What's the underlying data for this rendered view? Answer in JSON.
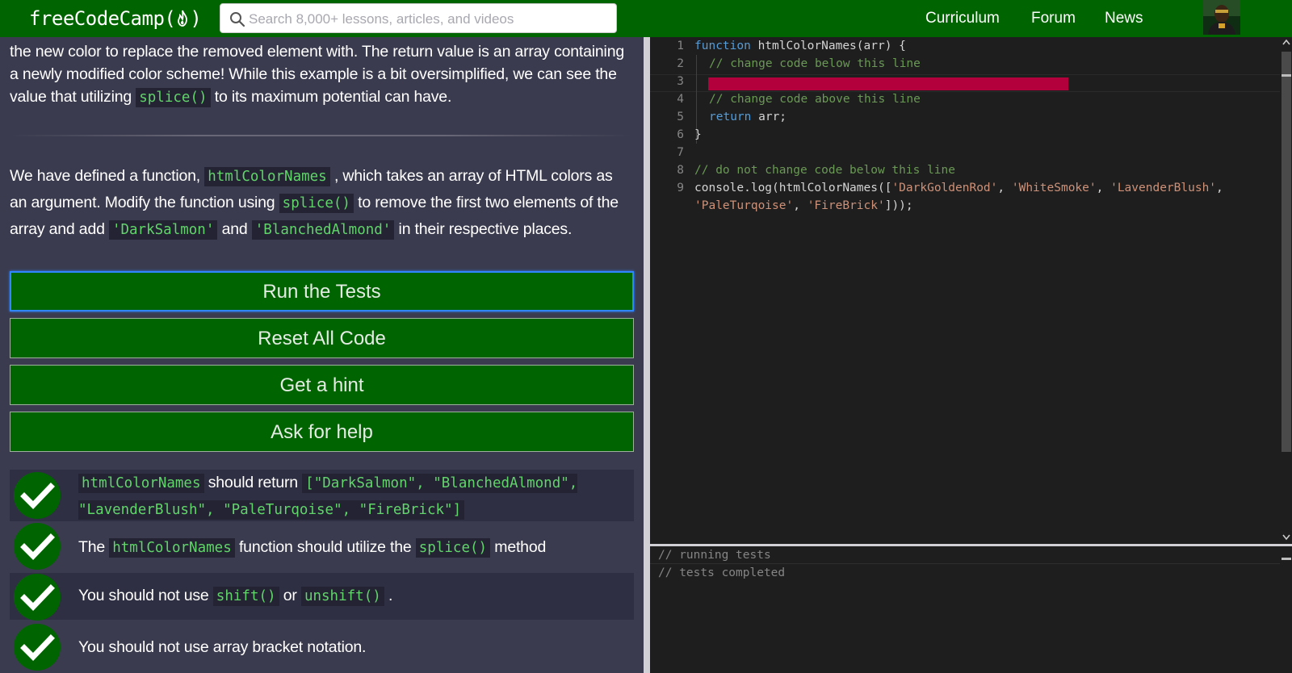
{
  "navbar": {
    "logo_text": "freeCodeCamp(",
    "logo_close": ")",
    "search_placeholder": "Search 8,000+ lessons, articles, and videos",
    "links": [
      "Curriculum",
      "Forum",
      "News"
    ]
  },
  "description": {
    "para1": {
      "text_a": "the new color to replace the removed element with. The return value is an array containing a newly modified color scheme! While this example is a bit oversimplified, we can see the value that utilizing ",
      "code_a": "splice()",
      "text_b": " to its maximum potential can have."
    },
    "para2": {
      "text_a": "We have defined a function, ",
      "code_a": "htmlColorNames",
      "text_b": " , which takes an array of HTML colors as an argument. Modify the function using ",
      "code_b": "splice()",
      "text_c": " to remove the first two elements of the array and add ",
      "code_c": "'DarkSalmon'",
      "text_d": " and ",
      "code_d": "'BlanchedAlmond'",
      "text_e": " in their respective places."
    }
  },
  "buttons": {
    "run": "Run the Tests",
    "reset": "Reset All Code",
    "hint": "Get a hint",
    "help": "Ask for help"
  },
  "tests": [
    {
      "passed": true,
      "code_a": "htmlColorNames",
      "text_a": " should return ",
      "code_b": "[\"DarkSalmon\", \"BlanchedAlmond\", \"LavenderBlush\", \"PaleTurqoise\", \"FireBrick\"]"
    },
    {
      "passed": true,
      "text_a": "The ",
      "code_a": "htmlColorNames",
      "text_b": " function should utilize the ",
      "code_b": "splice()",
      "text_c": " method"
    },
    {
      "passed": true,
      "text_a": "You should not use ",
      "code_a": "shift()",
      "text_b": " or ",
      "code_b": "unshift()",
      "text_c": " ."
    },
    {
      "passed": true,
      "text_a": "You should not use array bracket notation."
    }
  ],
  "editor": {
    "line_numbers": [
      "1",
      "2",
      "3",
      "4",
      "5",
      "6",
      "7",
      "8",
      "9"
    ],
    "l1_kw": "function",
    "l1_rest": " htmlColorNames(arr) {",
    "l2": "// change code below this line",
    "l4": "// change code above this line",
    "l5_kw": "return",
    "l5_rest": " arr;",
    "l6": "}",
    "l8": "// do not change code below this line",
    "l9_a": "console.log(htmlColorNames([",
    "l9_s1": "'DarkGoldenRod'",
    "l9_c1": ", ",
    "l9_s2": "'WhiteSmoke'",
    "l9_c2": ", ",
    "l9_s3": "'LavenderBlush'",
    "l9_c3": ",",
    "l9b_s4": "'PaleTurqoise'",
    "l9b_c4": ", ",
    "l9b_s5": "'FireBrick'",
    "l9b_end": "]));"
  },
  "output": {
    "line1": "// running tests",
    "line2": "// tests completed"
  },
  "colors": {
    "brand_green": "#006400",
    "code_green": "#61d46a",
    "focus_blue": "#2f86ff",
    "error_red": "#b3003c"
  }
}
